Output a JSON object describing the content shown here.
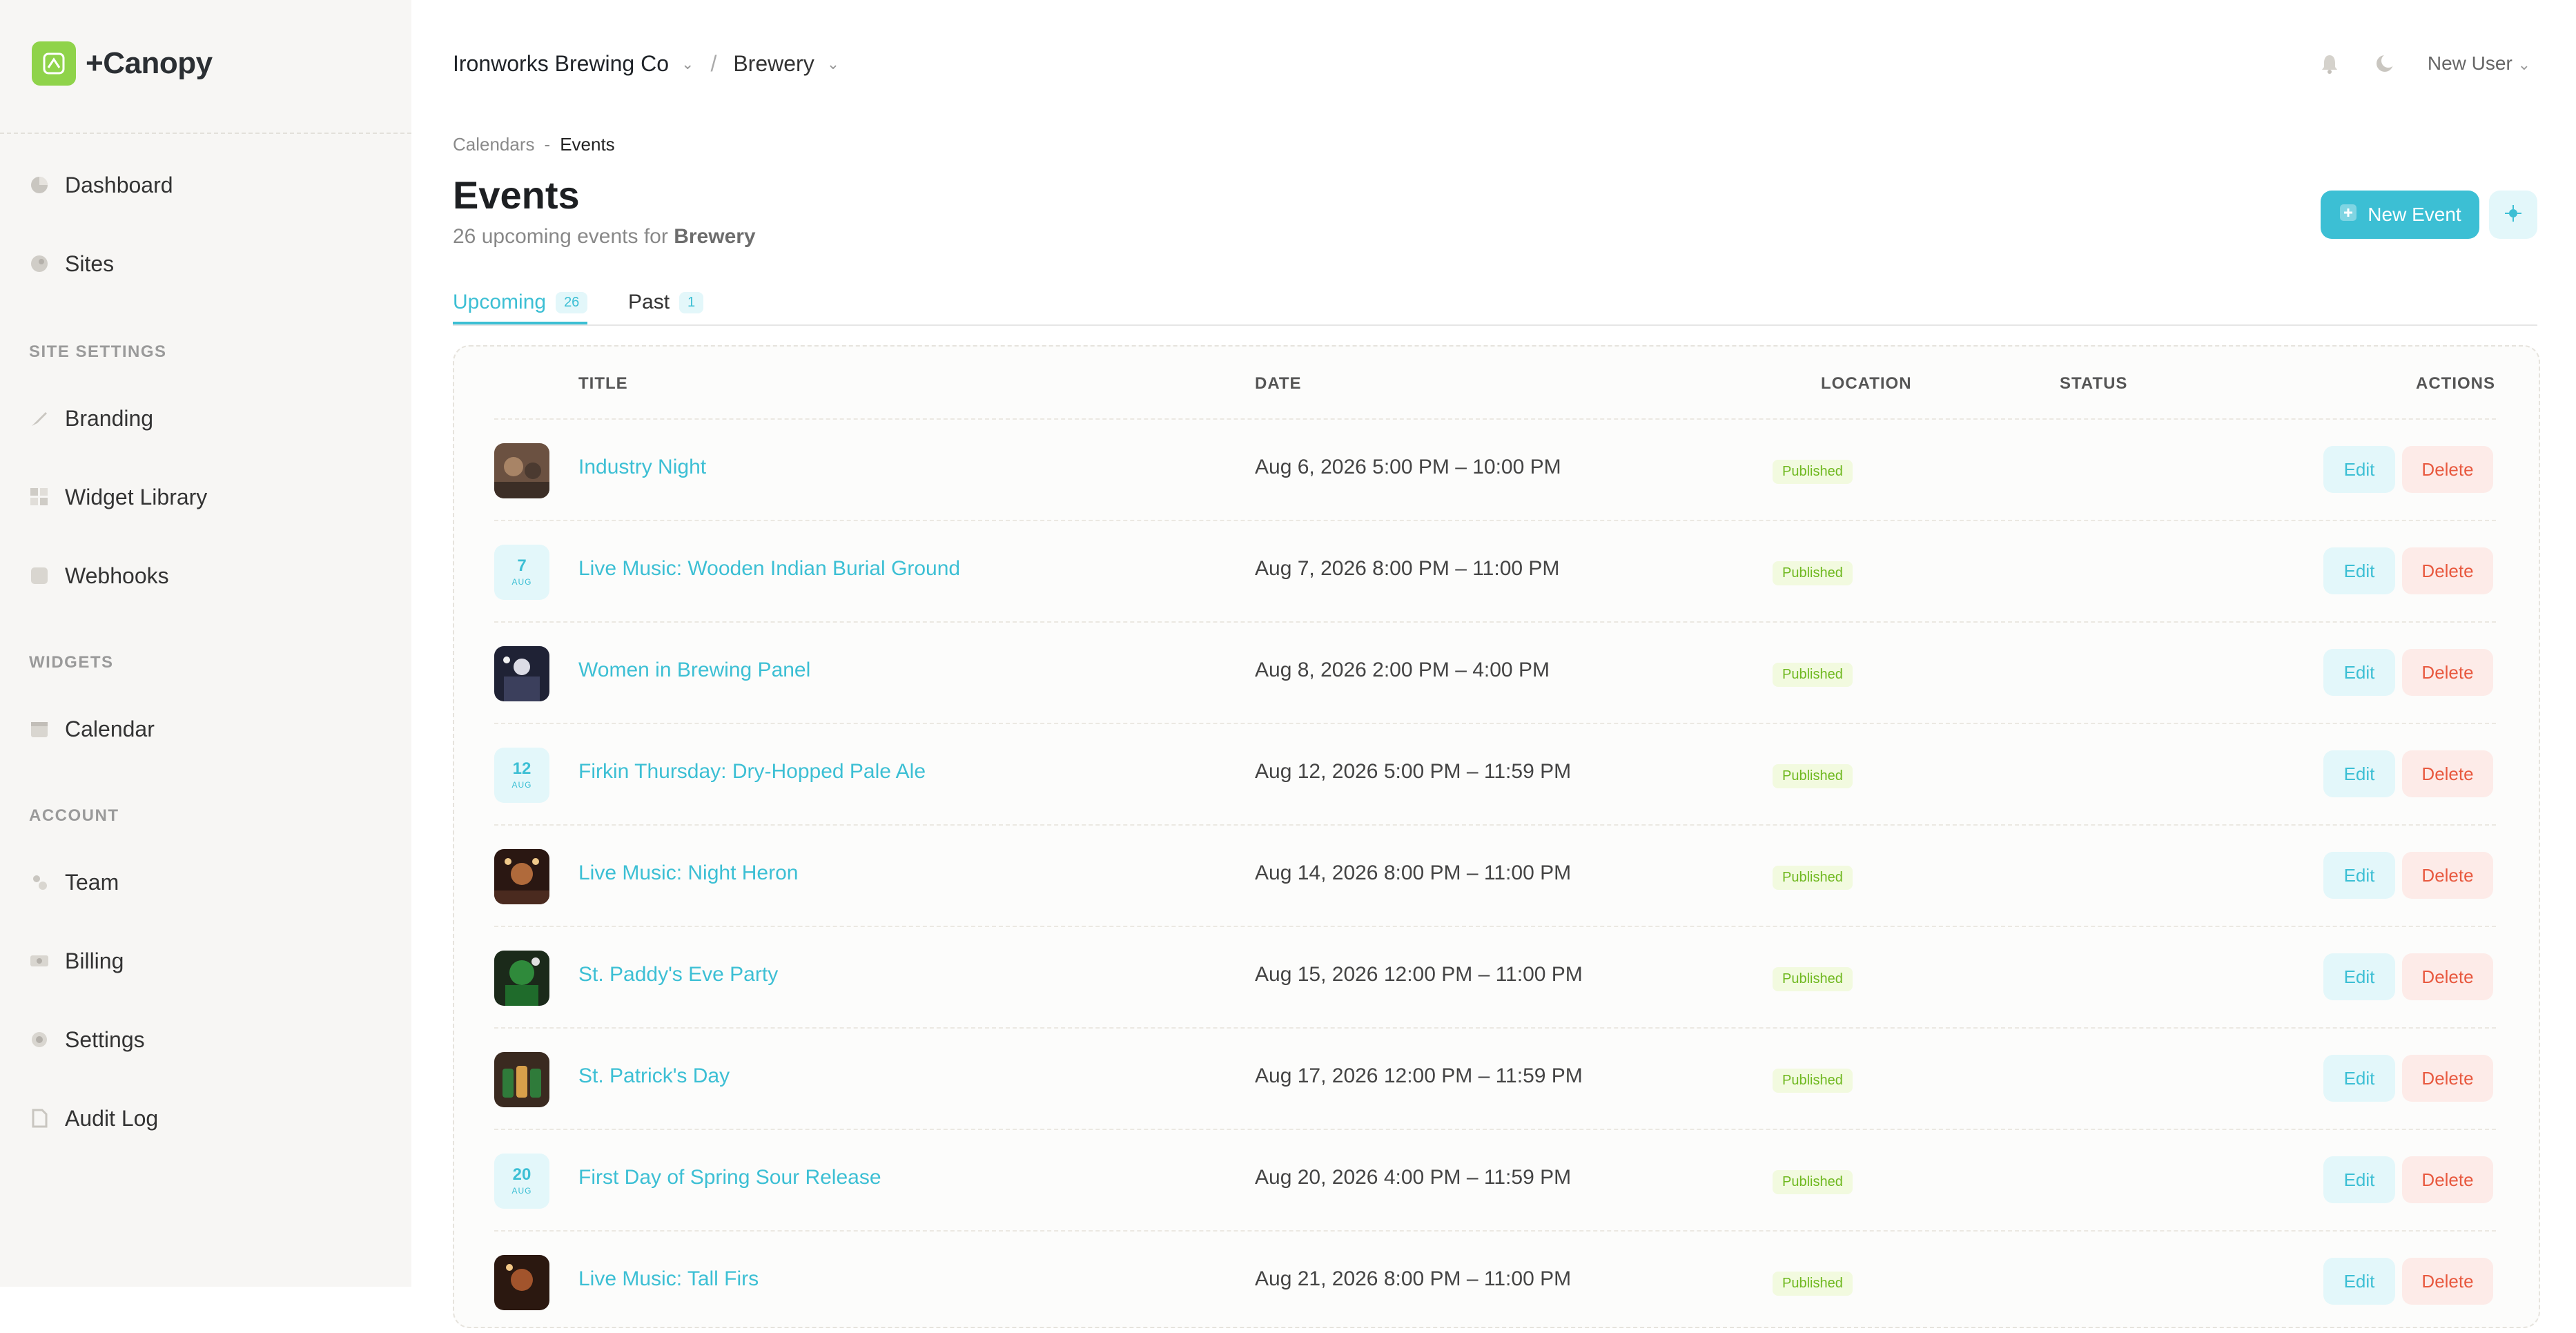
{
  "brand": {
    "name": "+Canopy"
  },
  "sidebar": {
    "nav": [
      {
        "label": "Dashboard",
        "icon": "pie-chart-icon"
      },
      {
        "label": "Sites",
        "icon": "globe-icon"
      }
    ],
    "site_settings_header": "SITE SETTINGS",
    "site_settings": [
      {
        "label": "Branding",
        "icon": "brush-icon"
      },
      {
        "label": "Widget Library",
        "icon": "grid-icon"
      },
      {
        "label": "Webhooks",
        "icon": "webhook-icon"
      }
    ],
    "widgets_header": "WIDGETS",
    "widgets": [
      {
        "label": "Calendar",
        "icon": "calendar-icon"
      }
    ],
    "account_header": "ACCOUNT",
    "account": [
      {
        "label": "Team",
        "icon": "team-icon"
      },
      {
        "label": "Billing",
        "icon": "billing-icon"
      },
      {
        "label": "Settings",
        "icon": "gear-icon"
      },
      {
        "label": "Audit Log",
        "icon": "document-icon"
      }
    ]
  },
  "topbar": {
    "org": "Ironworks Brewing Co",
    "site": "Brewery",
    "user": "New User"
  },
  "breadcrumb": {
    "parent": "Calendars",
    "separator": "-",
    "current": "Events"
  },
  "page": {
    "title": "Events",
    "subtitle_prefix": "26 upcoming events for",
    "subtitle_site": "Brewery",
    "new_event_label": "New Event"
  },
  "tabs": [
    {
      "label": "Upcoming",
      "count": "26"
    },
    {
      "label": "Past",
      "count": "1"
    }
  ],
  "table": {
    "headers": {
      "title": "TITLE",
      "date": "DATE",
      "location": "LOCATION",
      "status": "STATUS",
      "actions": "ACTIONS"
    },
    "edit_label": "Edit",
    "delete_label": "Delete",
    "rows": [
      {
        "thumb": "photo",
        "title": "Industry Night",
        "date": "Aug 6, 2026 5:00 PM – 10:00 PM",
        "status": "Published"
      },
      {
        "thumb": "date",
        "day": "7",
        "month": "AUG",
        "title": "Live Music: Wooden Indian Burial Ground",
        "date": "Aug 7, 2026 8:00 PM – 11:00 PM",
        "status": "Published"
      },
      {
        "thumb": "photo",
        "title": "Women in Brewing Panel",
        "date": "Aug 8, 2026 2:00 PM – 4:00 PM",
        "status": "Published"
      },
      {
        "thumb": "date",
        "day": "12",
        "month": "AUG",
        "title": "Firkin Thursday: Dry-Hopped Pale Ale",
        "date": "Aug 12, 2026 5:00 PM – 11:59 PM",
        "status": "Published"
      },
      {
        "thumb": "photo",
        "title": "Live Music: Night Heron",
        "date": "Aug 14, 2026 8:00 PM – 11:00 PM",
        "status": "Published"
      },
      {
        "thumb": "photo",
        "title": "St. Paddy's Eve Party",
        "date": "Aug 15, 2026 12:00 PM – 11:00 PM",
        "status": "Published"
      },
      {
        "thumb": "photo",
        "title": "St. Patrick's Day",
        "date": "Aug 17, 2026 12:00 PM – 11:59 PM",
        "status": "Published"
      },
      {
        "thumb": "date",
        "day": "20",
        "month": "AUG",
        "title": "First Day of Spring Sour Release",
        "date": "Aug 20, 2026 4:00 PM – 11:59 PM",
        "status": "Published"
      },
      {
        "thumb": "photo",
        "title": "Live Music: Tall Firs",
        "date": "Aug 21, 2026 8:00 PM – 11:00 PM",
        "status": "Published"
      }
    ]
  },
  "colors": {
    "accent": "#3cbfd4",
    "brand_green": "#8fd34a",
    "published": "#6fb81f",
    "danger": "#e8593f"
  }
}
